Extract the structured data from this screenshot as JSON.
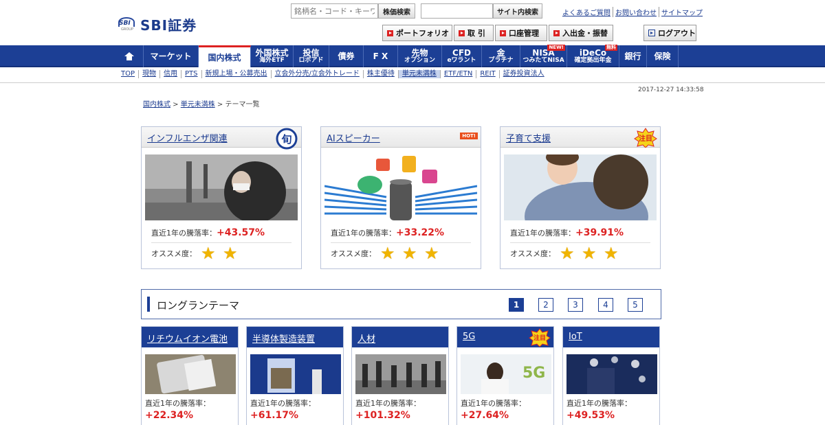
{
  "logo": {
    "mark": "SBI",
    "group": "GROUP",
    "name": "SBI証券"
  },
  "search": {
    "stock_placeholder": "銘柄名・コード・キーワード",
    "stock_button": "株価検索",
    "site_placeholder": "",
    "site_button": "サイト内検索"
  },
  "top_links": [
    "よくあるご質問",
    "お問い合わせ",
    "サイトマップ"
  ],
  "header_buttons": {
    "portfolio": "ポートフォリオ",
    "trade": "取 引",
    "account": "口座管理",
    "deposit": "入出金・振替",
    "logout": "ログアウト"
  },
  "nav": {
    "home": "home-icon",
    "items": [
      {
        "l1": "マーケット",
        "l2": ""
      },
      {
        "l1": "国内株式",
        "l2": ""
      },
      {
        "l1": "外国株式",
        "l2": "海外ETF"
      },
      {
        "l1": "投信",
        "l2": "ロボアド"
      },
      {
        "l1": "債券",
        "l2": ""
      },
      {
        "l1": "F X",
        "l2": ""
      },
      {
        "l1": "先物",
        "l2": "オプション"
      },
      {
        "l1": "CFD",
        "l2": "eワラント"
      },
      {
        "l1": "金",
        "l2": "プラチナ"
      },
      {
        "l1": "NISA",
        "l2": "つみたてNISA",
        "badge": "NEW!"
      },
      {
        "l1": "iDeCo",
        "l2": "確定拠出年金",
        "badge": "無料"
      },
      {
        "l1": "銀行",
        "l2": ""
      },
      {
        "l1": "保険",
        "l2": ""
      }
    ]
  },
  "subnav": [
    "TOP",
    "現物",
    "信用",
    "PTS",
    "新規上場・公募売出",
    "立会外分売/立会外トレード",
    "株主優待",
    "単元未満株",
    "ETF/ETN",
    "REIT",
    "証券投資法人"
  ],
  "timestamp": "2017-12-27 14:33:58",
  "breadcrumb": {
    "a": "国内株式",
    "b": "単元未満株",
    "current": "テーマ一覧",
    "sep": " > "
  },
  "feature_cards": [
    {
      "title": "インフルエンザ関連",
      "rate_label": "直近1年の騰落率：",
      "rate": "+43.57%",
      "stars_label": "オススメ度：",
      "stars": 2,
      "tag": "旬"
    },
    {
      "title": "AIスピーカー",
      "rate_label": "直近1年の騰落率：",
      "rate": "+33.22%",
      "stars_label": "オススメ度：",
      "stars": 3,
      "tag": "HOT!"
    },
    {
      "title": "子育て支援",
      "rate_label": "直近1年の騰落率：",
      "rate": "+39.91%",
      "stars_label": "オススメ度：",
      "stars": 3,
      "tag": "注目"
    }
  ],
  "longrun": {
    "title": "ロングランテーマ",
    "pages": [
      "1",
      "2",
      "3",
      "4",
      "5"
    ],
    "current_page": "1"
  },
  "small_cards": [
    {
      "title": "リチウムイオン電池",
      "rate_label": "直近1年の騰落率：",
      "rate": "+22.34%"
    },
    {
      "title": "半導体製造装置",
      "rate_label": "直近1年の騰落率：",
      "rate": "+61.17%"
    },
    {
      "title": "人材",
      "rate_label": "直近1年の騰落率：",
      "rate": "+101.32%"
    },
    {
      "title": "5G",
      "rate_label": "直近1年の騰落率：",
      "rate": "+27.64%",
      "tag": "注目"
    },
    {
      "title": "IoT",
      "rate_label": "直近1年の騰落率：",
      "rate": "+49.53%"
    }
  ],
  "colors": {
    "brand": "#1c3f95",
    "accent_red": "#d22222",
    "star": "#f0b400"
  }
}
